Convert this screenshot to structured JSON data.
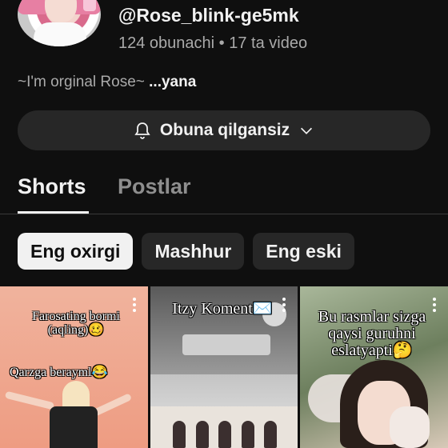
{
  "channel": {
    "handle": "@Rose_blink-ge5mk",
    "stats": "124 obunachi • 17 ta video",
    "bio": "~I'm orginal Rose~",
    "bio_more": "...yana"
  },
  "subscribe": {
    "label": "Obuna qilgansiz"
  },
  "tabs": [
    {
      "label": "Shorts",
      "active": true
    },
    {
      "label": "Postlar",
      "active": false
    }
  ],
  "filters": [
    {
      "label": "Eng oxirgi",
      "active": true
    },
    {
      "label": "Mashhur",
      "active": false
    },
    {
      "label": "Eng eski",
      "active": false
    }
  ],
  "shorts": [
    {
      "caption_top": "Farosating bormi (aqling)🥴",
      "caption_bottom": "Qarzga berayml😂",
      "menu_icon": "more-vert-icon"
    },
    {
      "caption_top": "Itzy Koment✉️",
      "menu_icon": "more-vert-icon"
    },
    {
      "caption_top": "Bu rasmlar sizga qaysi guruhni eslatyapti🤔",
      "menu_icon": "more-vert-icon"
    }
  ],
  "colors": {
    "background": "#0f0f0f",
    "text": "#f1f1f1",
    "secondary_text": "#aaaaaa",
    "chip_bg": "#272727",
    "chip_active_bg": "#f1f1f1"
  }
}
